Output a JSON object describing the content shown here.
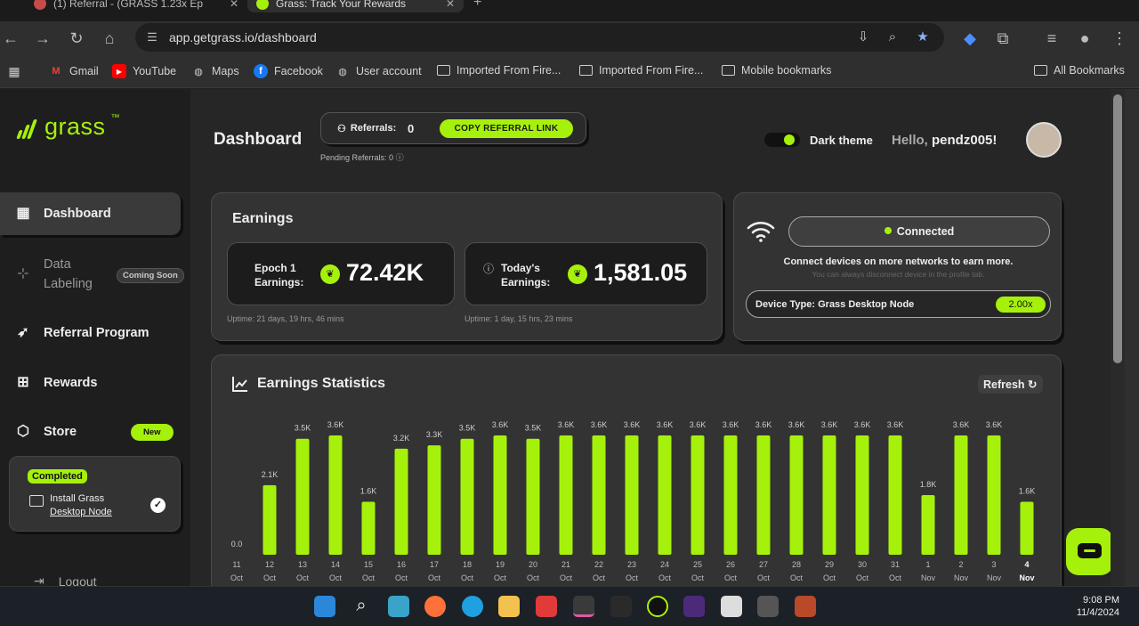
{
  "browser": {
    "tabs": [
      {
        "label": "(1) Referral - (GRASS 1.23x Ep"
      },
      {
        "label": "Grass: Track Your Rewards"
      }
    ],
    "url": "app.getgrass.io/dashboard",
    "bookmarks": [
      "Gmail",
      "YouTube",
      "Maps",
      "Facebook",
      "User account",
      "Imported From Fire...",
      "Imported From Fire...",
      "Mobile bookmarks"
    ],
    "all_bookmarks": "All Bookmarks"
  },
  "brand": {
    "name": "grass",
    "tm": "™",
    "accent": "#a6f10b"
  },
  "sidebar": {
    "items": [
      {
        "label": "Dashboard",
        "icon": "grid-icon"
      },
      {
        "label": "Data\nLabeling",
        "icon": "data-labeling-icon"
      },
      {
        "label": "Referral Program",
        "icon": "rocket-icon"
      },
      {
        "label": "Rewards",
        "icon": "gift-icon"
      },
      {
        "label": "Store",
        "icon": "cube-icon"
      }
    ],
    "coming_soon": "Coming Soon",
    "new_badge": "New",
    "completed": {
      "badge": "Completed",
      "line1": "Install Grass",
      "line2": "Desktop Node"
    },
    "logout": "Logout"
  },
  "header": {
    "title": "Dashboard",
    "referrals_label": "Referrals:",
    "referrals_value": "0",
    "copy_button": "COPY REFERRAL LINK",
    "pending": "Pending Referrals: 0",
    "theme_label": "Dark theme",
    "hello": "Hello, ",
    "username": "pendz005!"
  },
  "earnings": {
    "title": "Earnings",
    "epoch_label_1": "Epoch 1",
    "epoch_label_2": "Earnings:",
    "epoch_value": "72.42K",
    "today_label_1": "Today's",
    "today_label_2": "Earnings:",
    "today_value": "1,581.05",
    "uptime_1": "Uptime: 21 days, 19 hrs, 46 mins",
    "uptime_2": "Uptime: 1 day, 15 hrs, 23 mins"
  },
  "connection": {
    "status": "Connected",
    "message": "Connect devices on more networks to earn more.",
    "sub": "You can always disconnect device in the profile tab.",
    "device_type": "Device Type:  Grass Desktop Node",
    "multiplier": "2.00x"
  },
  "stats": {
    "title": "Earnings Statistics",
    "refresh": "Refresh"
  },
  "chart_data": {
    "type": "bar",
    "categories": [
      "11 Oct",
      "12 Oct",
      "13 Oct",
      "14 Oct",
      "15 Oct",
      "16 Oct",
      "17 Oct",
      "18 Oct",
      "19 Oct",
      "20 Oct",
      "21 Oct",
      "22 Oct",
      "23 Oct",
      "24 Oct",
      "25 Oct",
      "26 Oct",
      "27 Oct",
      "28 Oct",
      "29 Oct",
      "30 Oct",
      "31 Oct",
      "1 Nov",
      "2 Nov",
      "3 Nov",
      "4 Nov"
    ],
    "day_labels": [
      "11",
      "12",
      "13",
      "14",
      "15",
      "16",
      "17",
      "18",
      "19",
      "20",
      "21",
      "22",
      "23",
      "24",
      "25",
      "26",
      "27",
      "28",
      "29",
      "30",
      "31",
      "1",
      "2",
      "3",
      "4"
    ],
    "month_labels": [
      "Oct",
      "Oct",
      "Oct",
      "Oct",
      "Oct",
      "Oct",
      "Oct",
      "Oct",
      "Oct",
      "Oct",
      "Oct",
      "Oct",
      "Oct",
      "Oct",
      "Oct",
      "Oct",
      "Oct",
      "Oct",
      "Oct",
      "Oct",
      "Oct",
      "Nov",
      "Nov",
      "Nov",
      "Nov"
    ],
    "values": [
      0,
      2100,
      3500,
      3600,
      1600,
      3200,
      3300,
      3500,
      3600,
      3500,
      3600,
      3600,
      3600,
      3600,
      3600,
      3600,
      3600,
      3600,
      3600,
      3600,
      3600,
      1800,
      3600,
      3600,
      1600
    ],
    "value_labels": [
      "0.0",
      "2.1K",
      "3.5K",
      "3.6K",
      "1.6K",
      "3.2K",
      "3.3K",
      "3.5K",
      "3.6K",
      "3.5K",
      "3.6K",
      "3.6K",
      "3.6K",
      "3.6K",
      "3.6K",
      "3.6K",
      "3.6K",
      "3.6K",
      "3.6K",
      "3.6K",
      "3.6K",
      "1.8K",
      "3.6K",
      "3.6K",
      "1.6K"
    ],
    "highlight_index": 24,
    "bar_color": "#a6f10b",
    "ylim": [
      0,
      3600
    ]
  },
  "taskbar": {
    "time": "9:08 PM",
    "date": "11/4/2024"
  }
}
